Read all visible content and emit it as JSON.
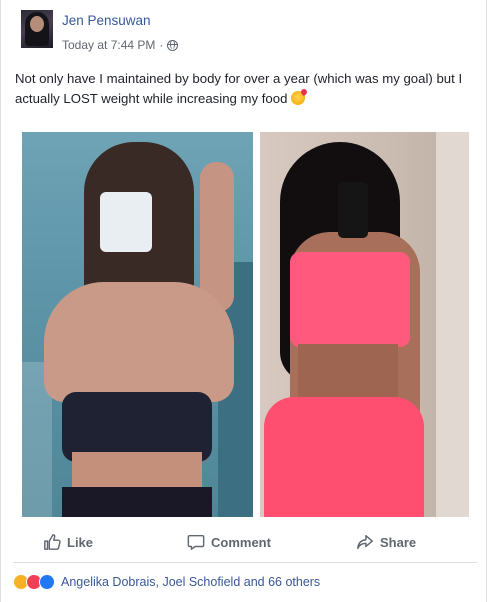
{
  "post": {
    "author": "Jen Pensuwan",
    "timestamp": "Today at 7:44 PM",
    "separator": "·",
    "privacy_icon": "globe-icon",
    "text": "Not only have I maintained by body for over a year (which was my goal) but I actually LOST weight while increasing my food",
    "emoji": "smiling-face-with-hearts-emoji"
  },
  "actions": {
    "like_label": "Like",
    "comment_label": "Comment",
    "share_label": "Share"
  },
  "reactions": {
    "icons": [
      "wow-reaction-icon",
      "love-reaction-icon",
      "like-reaction-icon"
    ],
    "summary": "Angelika Dobrais, Joel Schofield and 66 others"
  },
  "colors": {
    "link": "#385898",
    "meta": "#616770",
    "text": "#1d2129",
    "action": "#606770"
  }
}
